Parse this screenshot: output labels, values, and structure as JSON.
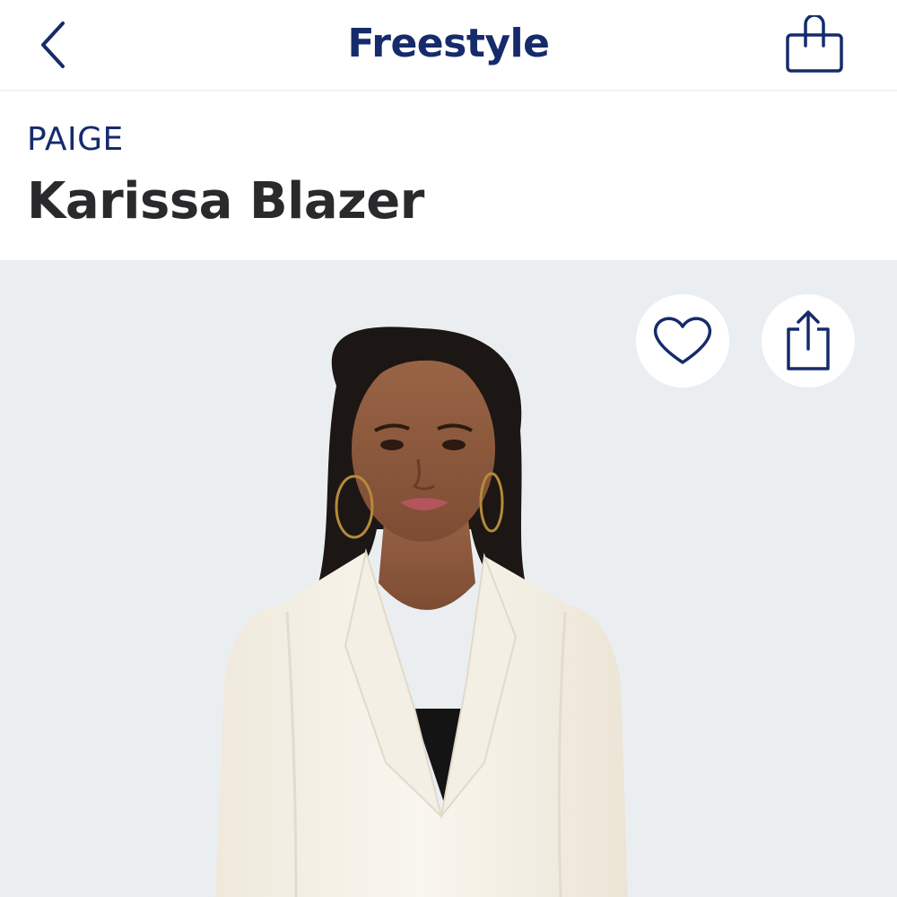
{
  "nav": {
    "title": "Freestyle",
    "back_icon": "chevron-left-icon",
    "bag_icon": "shopping-bag-icon"
  },
  "product": {
    "brand": "PAIGE",
    "name": "Karissa Blazer"
  },
  "image_actions": {
    "favorite_icon": "heart-icon",
    "share_icon": "share-icon"
  },
  "colors": {
    "accent": "#152b6b",
    "text": "#2a2a2d",
    "image_background": "#ebeef1"
  }
}
